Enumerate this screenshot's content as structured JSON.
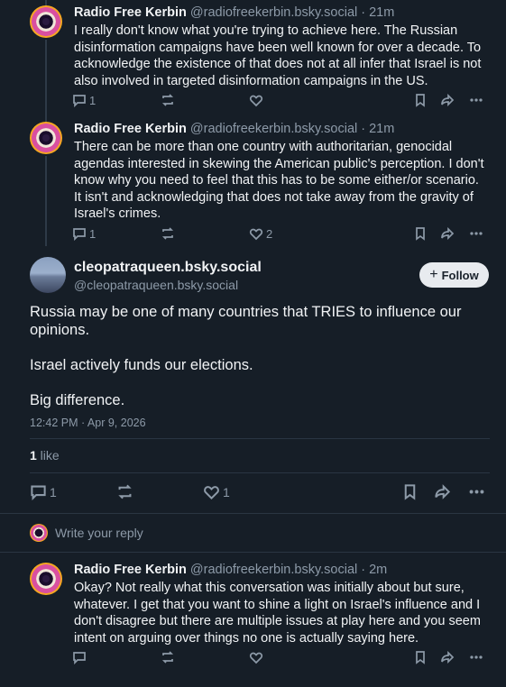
{
  "posts": [
    {
      "author_name": "Radio Free Kerbin",
      "author_handle": "@radiofreekerbin.bsky.social · 21m",
      "text": "I really don't know what you're trying to achieve here. The Russian disinformation campaigns have been well known for over a decade. To acknowledge the existence of that does not at all infer that Israel is not also involved in targeted disinformation campaigns in the US.",
      "reply_count": "1",
      "repost_count": "",
      "like_count": ""
    },
    {
      "author_name": "Radio Free Kerbin",
      "author_handle": "@radiofreekerbin.bsky.social · 21m",
      "text": "There can be more than one country with authoritarian, genocidal agendas interested in skewing the American public's perception. I don't know why you need to feel that this has to be some either/or scenario. It isn't and acknowledging that does not take away from the gravity of Israel's crimes.",
      "reply_count": "1",
      "repost_count": "",
      "like_count": "2"
    }
  ],
  "focus": {
    "display_name": "cleopatraqueen.bsky.social",
    "handle": "@cleopatraqueen.bsky.social",
    "follow_label": "Follow",
    "follow_plus": "+",
    "paragraphs": [
      "Russia may be one of many countries that TRIES to influence our opinions.",
      "Israel actively funds our elections.",
      "Big difference."
    ],
    "timestamp": "12:42 PM · Apr 9, 2026",
    "like_total": "1",
    "like_word": " like",
    "reply_count": "1",
    "like_count": "1"
  },
  "reply_prompt": "Write your reply",
  "reply_post": {
    "author_name": "Radio Free Kerbin",
    "author_handle": "@radiofreekerbin.bsky.social · 2m",
    "text": "Okay? Not really what this conversation was initially about but sure, whatever. I get that you want to shine a light on Israel's influence and I don't disagree but there are multiple issues at play here and you seem intent on arguing over things no one is actually saying here."
  },
  "icons": [
    "reply-icon",
    "repost-icon",
    "like-icon",
    "bookmark-icon",
    "share-icon",
    "more-icon"
  ],
  "colors": {
    "background": "#161e27",
    "text": "#f1f3f5",
    "muted": "#8d9aa8",
    "follow_bg": "#e8ebef"
  }
}
